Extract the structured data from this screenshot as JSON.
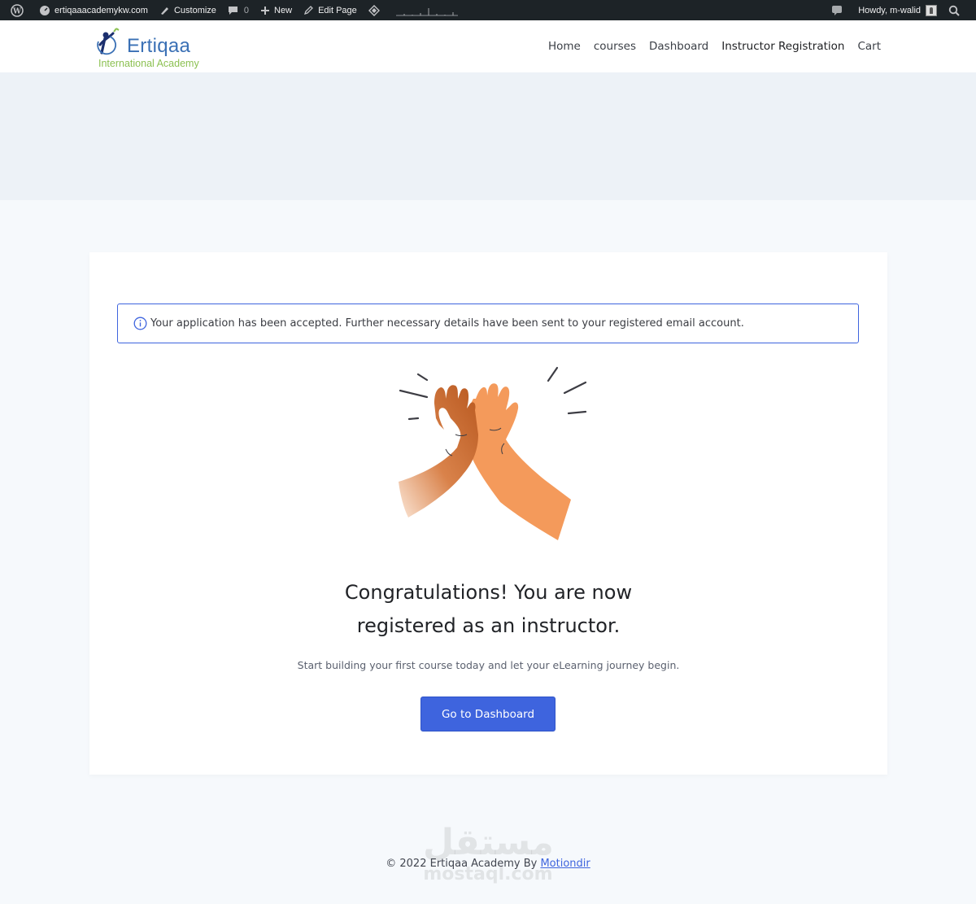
{
  "admin_bar": {
    "site": "ertiqaaacademykw.com",
    "customize": "Customize",
    "comments_count": "0",
    "new": "New",
    "edit_page": "Edit Page",
    "howdy": "Howdy, m-walid"
  },
  "header": {
    "logo_title": "Ertiqaa",
    "logo_subtitle": "International Academy",
    "nav": [
      "Home",
      "courses",
      "Dashboard",
      "Instructor Registration",
      "Cart"
    ]
  },
  "notice": {
    "text": "Your application has been accepted. Further necessary details have been sent to your registered email account."
  },
  "main": {
    "heading_line1": "Congratulations! You are now",
    "heading_line2": "registered as an instructor.",
    "subtext": "Start building your first course today and let your eLearning journey begin.",
    "button_label": "Go to Dashboard"
  },
  "footer": {
    "copyright": "© 2022 Ertiqaa Academy By ",
    "link_label": "Motiondir"
  },
  "watermark": {
    "arabic": "مستقل",
    "latin": "mostaql.com"
  },
  "colors": {
    "accent": "#3e64de",
    "admin_bar": "#1d2327",
    "logo_blue": "#3a70b5",
    "logo_green": "#8cc152",
    "hand_dark": "#b8581f",
    "hand_light": "#f49a5b"
  }
}
